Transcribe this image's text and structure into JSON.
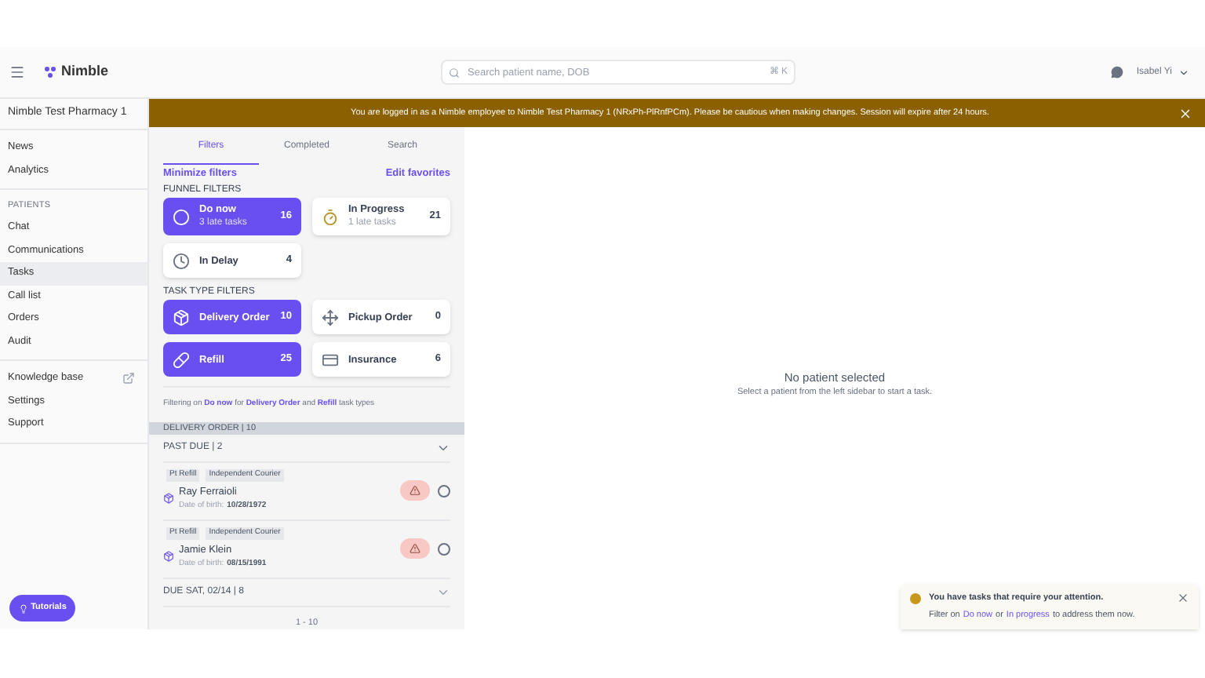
{
  "header": {
    "logo": "Nimble",
    "search": {
      "placeholder": "Search patient name, DOB",
      "shortcut": "⌘ K"
    },
    "user": "Isabel Yi"
  },
  "banner": {
    "text": "You are logged in as a Nimble employee to Nimble Test Pharmacy 1 (NRxPh-PlRnfPCm). Please be cautious when making changes. Session will expire after 24 hours."
  },
  "sidebar": {
    "pharmacy": "Nimble Test Pharmacy 1",
    "groups": [
      {
        "items": [
          {
            "label": "News",
            "selected": false
          },
          {
            "label": "Analytics",
            "selected": false
          }
        ]
      },
      {
        "heading": "PATIENTS",
        "items": [
          {
            "label": "Chat",
            "selected": false
          },
          {
            "label": "Communications",
            "selected": false
          },
          {
            "label": "Tasks",
            "selected": true
          },
          {
            "label": "Call list",
            "selected": false
          },
          {
            "label": "Orders",
            "selected": false
          },
          {
            "label": "Audit",
            "selected": false
          }
        ]
      },
      {
        "items": [
          {
            "label": "Knowledge base",
            "selected": false,
            "external": true
          },
          {
            "label": "Settings",
            "selected": false,
            "external": false
          },
          {
            "label": "Support",
            "selected": false,
            "external": false
          }
        ]
      }
    ],
    "tutorials": "Tutorials"
  },
  "tasks": {
    "tabs": [
      {
        "label": "Filters",
        "selected": true
      },
      {
        "label": "Completed",
        "selected": false
      },
      {
        "label": "Search",
        "selected": false
      }
    ],
    "minimize": "Minimize filters",
    "edit_favorites": "Edit favorites",
    "funnel_heading": "FUNNEL FILTERS",
    "funnel": [
      {
        "kind": "circle",
        "label": "Do now",
        "sub": "3 late tasks",
        "count": "16",
        "selected": true
      },
      {
        "kind": "progress",
        "label": "In Progress",
        "sub": "1 late tasks",
        "count": "21",
        "selected": false
      },
      {
        "kind": "clock",
        "label": "In Delay",
        "count": "4",
        "selected": false
      }
    ],
    "type_heading": "TASK TYPE FILTERS",
    "types": [
      {
        "kind": "box",
        "label": "Delivery Order",
        "count": "10",
        "selected": true
      },
      {
        "kind": "pickup",
        "label": "Pickup Order",
        "count": "0",
        "selected": false
      },
      {
        "kind": "bottle",
        "label": "Refill",
        "count": "25",
        "selected": true
      },
      {
        "kind": "card",
        "label": "Insurance",
        "count": "6",
        "selected": false
      }
    ],
    "filter_summary": "Filtering on **Do now** for **Delivery Order** and **Refill** task types",
    "section": "DELIVERY ORDER | 10",
    "groups": [
      {
        "label": "PAST DUE | 2",
        "expanded": true,
        "rows": [
          {
            "tags": [
              "Pt Refill",
              "Independent Courier"
            ],
            "name": "Ray Ferraioli",
            "dob_label": "Date of birth:",
            "dob": "10/28/1972",
            "checked": false
          },
          {
            "tags": [
              "Pt Refill",
              "Independent Courier"
            ],
            "name": "Jamie Klein",
            "dob_label": "Date of birth:",
            "dob": "08/15/1991",
            "checked": false
          }
        ]
      },
      {
        "label": "DUE SAT, 02/14 | 8",
        "expanded": false
      }
    ],
    "pagination": "1 - 10"
  },
  "main": {
    "title": "No patient selected",
    "subtitle": "Select a patient from the left sidebar to start a task."
  },
  "toast": {
    "title": "You have tasks that require your attention.",
    "parts": [
      {
        "kind": "text",
        "text": "Filter on"
      },
      {
        "kind": "link",
        "text": "Do now"
      },
      {
        "kind": "text",
        "text": "or"
      },
      {
        "kind": "link",
        "text": "In progress"
      },
      {
        "kind": "text",
        "text": "to address them now."
      }
    ]
  }
}
